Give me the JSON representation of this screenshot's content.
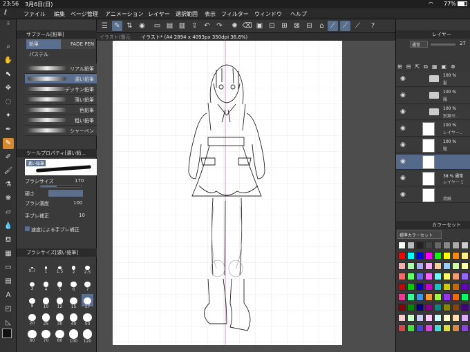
{
  "status": {
    "time": "23:56",
    "date": "3月6日(日)",
    "battery": "77%"
  },
  "menu": [
    "ファイル",
    "編集",
    "ページ管理",
    "アニメーション",
    "レイヤー",
    "選択範囲",
    "表示",
    "フィルター",
    "ウィンドウ",
    "ヘルプ"
  ],
  "sub_tool": {
    "header": "サブツール[鉛筆]",
    "tabs": [
      "鉛筆",
      "FADE PEN",
      "パステル"
    ],
    "brushes": [
      "リアル鉛筆",
      "濃い鉛筆",
      "デッサン鉛筆",
      "薄い鉛筆",
      "色鉛筆",
      "粗い鉛筆",
      "シャーペン"
    ],
    "selected_index": 1
  },
  "tool_property": {
    "header": "ツールプロパティ[濃い鉛...",
    "preview_label": "濃い鉛筆",
    "brush_size_label": "ブラシサイズ",
    "brush_size": "170",
    "hardness_label": "硬さ",
    "density_label": "ブラシ濃度",
    "density": "100",
    "stabilization_label": "手ブレ補正",
    "stabilization": "10",
    "speed_label": "速度による手ブレ補正"
  },
  "brush_size_panel": {
    "header": "ブラシサイズ[濃い鉛筆]",
    "sizes": [
      "0.7",
      "1",
      "1.5",
      "2",
      "2.5",
      "3",
      "4",
      "5",
      "6",
      "7",
      "8",
      "10",
      "12",
      "15",
      "17",
      "20",
      "25",
      "30",
      "40",
      "50",
      "60",
      "70",
      "80",
      "100",
      "120"
    ],
    "selected": "17"
  },
  "canvas": {
    "tab1": "イラスト(復元",
    "tab2": "イラスト* (A4 2894 x 4093px 350dpi 36.6%)"
  },
  "layer_panel": {
    "header": "レイヤー",
    "blend": "通常",
    "opacity": "27",
    "layers": [
      {
        "pct": "100 %",
        "name": "髪",
        "type": "folder"
      },
      {
        "pct": "100 %",
        "name": "服",
        "type": "folder"
      },
      {
        "pct": "100 %",
        "name": "別案セ..",
        "type": "folder"
      },
      {
        "pct": "100 %",
        "name": "レイヤー..",
        "type": "layer"
      },
      {
        "pct": "100 %",
        "name": "靴",
        "type": "layer"
      },
      {
        "pct": "",
        "name": "",
        "type": "selected"
      },
      {
        "pct": "38 % 通常",
        "name": "レイヤー 1",
        "type": "layer"
      },
      {
        "pct": "",
        "name": "用紙",
        "type": "paper"
      }
    ]
  },
  "color_set": {
    "header": "カラーセット",
    "set_name": "標準カラーセット",
    "colors": [
      "#ffffff",
      "#bbbbbb",
      "#222222",
      "#444444",
      "#666666",
      "#888888",
      "#aaaaaa",
      "#cccccc",
      "#ff0000",
      "#00ffff",
      "#0000ff",
      "#ff00ff",
      "#00ff00",
      "#ffff00",
      "#ff8800",
      "#ffee88",
      "#ffaaaa",
      "#aaffaa",
      "#aaaaff",
      "#ffaaff",
      "#ffcc99",
      "#99ccff",
      "#ccff99",
      "#ffffaa",
      "#ff6666",
      "#66ff66",
      "#6666ff",
      "#ff66ff",
      "#66ffff",
      "#ffff66",
      "#ff9966",
      "#9966ff",
      "#cc0000",
      "#00cc00",
      "#0000cc",
      "#cc00cc",
      "#00cccc",
      "#cccc00",
      "#cc6600",
      "#6600cc",
      "#ff3399",
      "#33ff99",
      "#3399ff",
      "#ff9933",
      "#99ff33",
      "#9933ff",
      "#ff6600",
      "#00ff66",
      "#880000",
      "#008800",
      "#000088",
      "#880088",
      "#008888",
      "#888800",
      "#884400",
      "#440088",
      "#ffcccc",
      "#ccffcc",
      "#ccccff",
      "#ffccff",
      "#ccffff",
      "#ffffcc",
      "#ffddaa",
      "#ddaaff",
      "#dd4444",
      "#44dd44",
      "#4444dd",
      "#dd44dd",
      "#44dddd",
      "#dddd44",
      "#dd8844",
      "#8844dd"
    ]
  }
}
